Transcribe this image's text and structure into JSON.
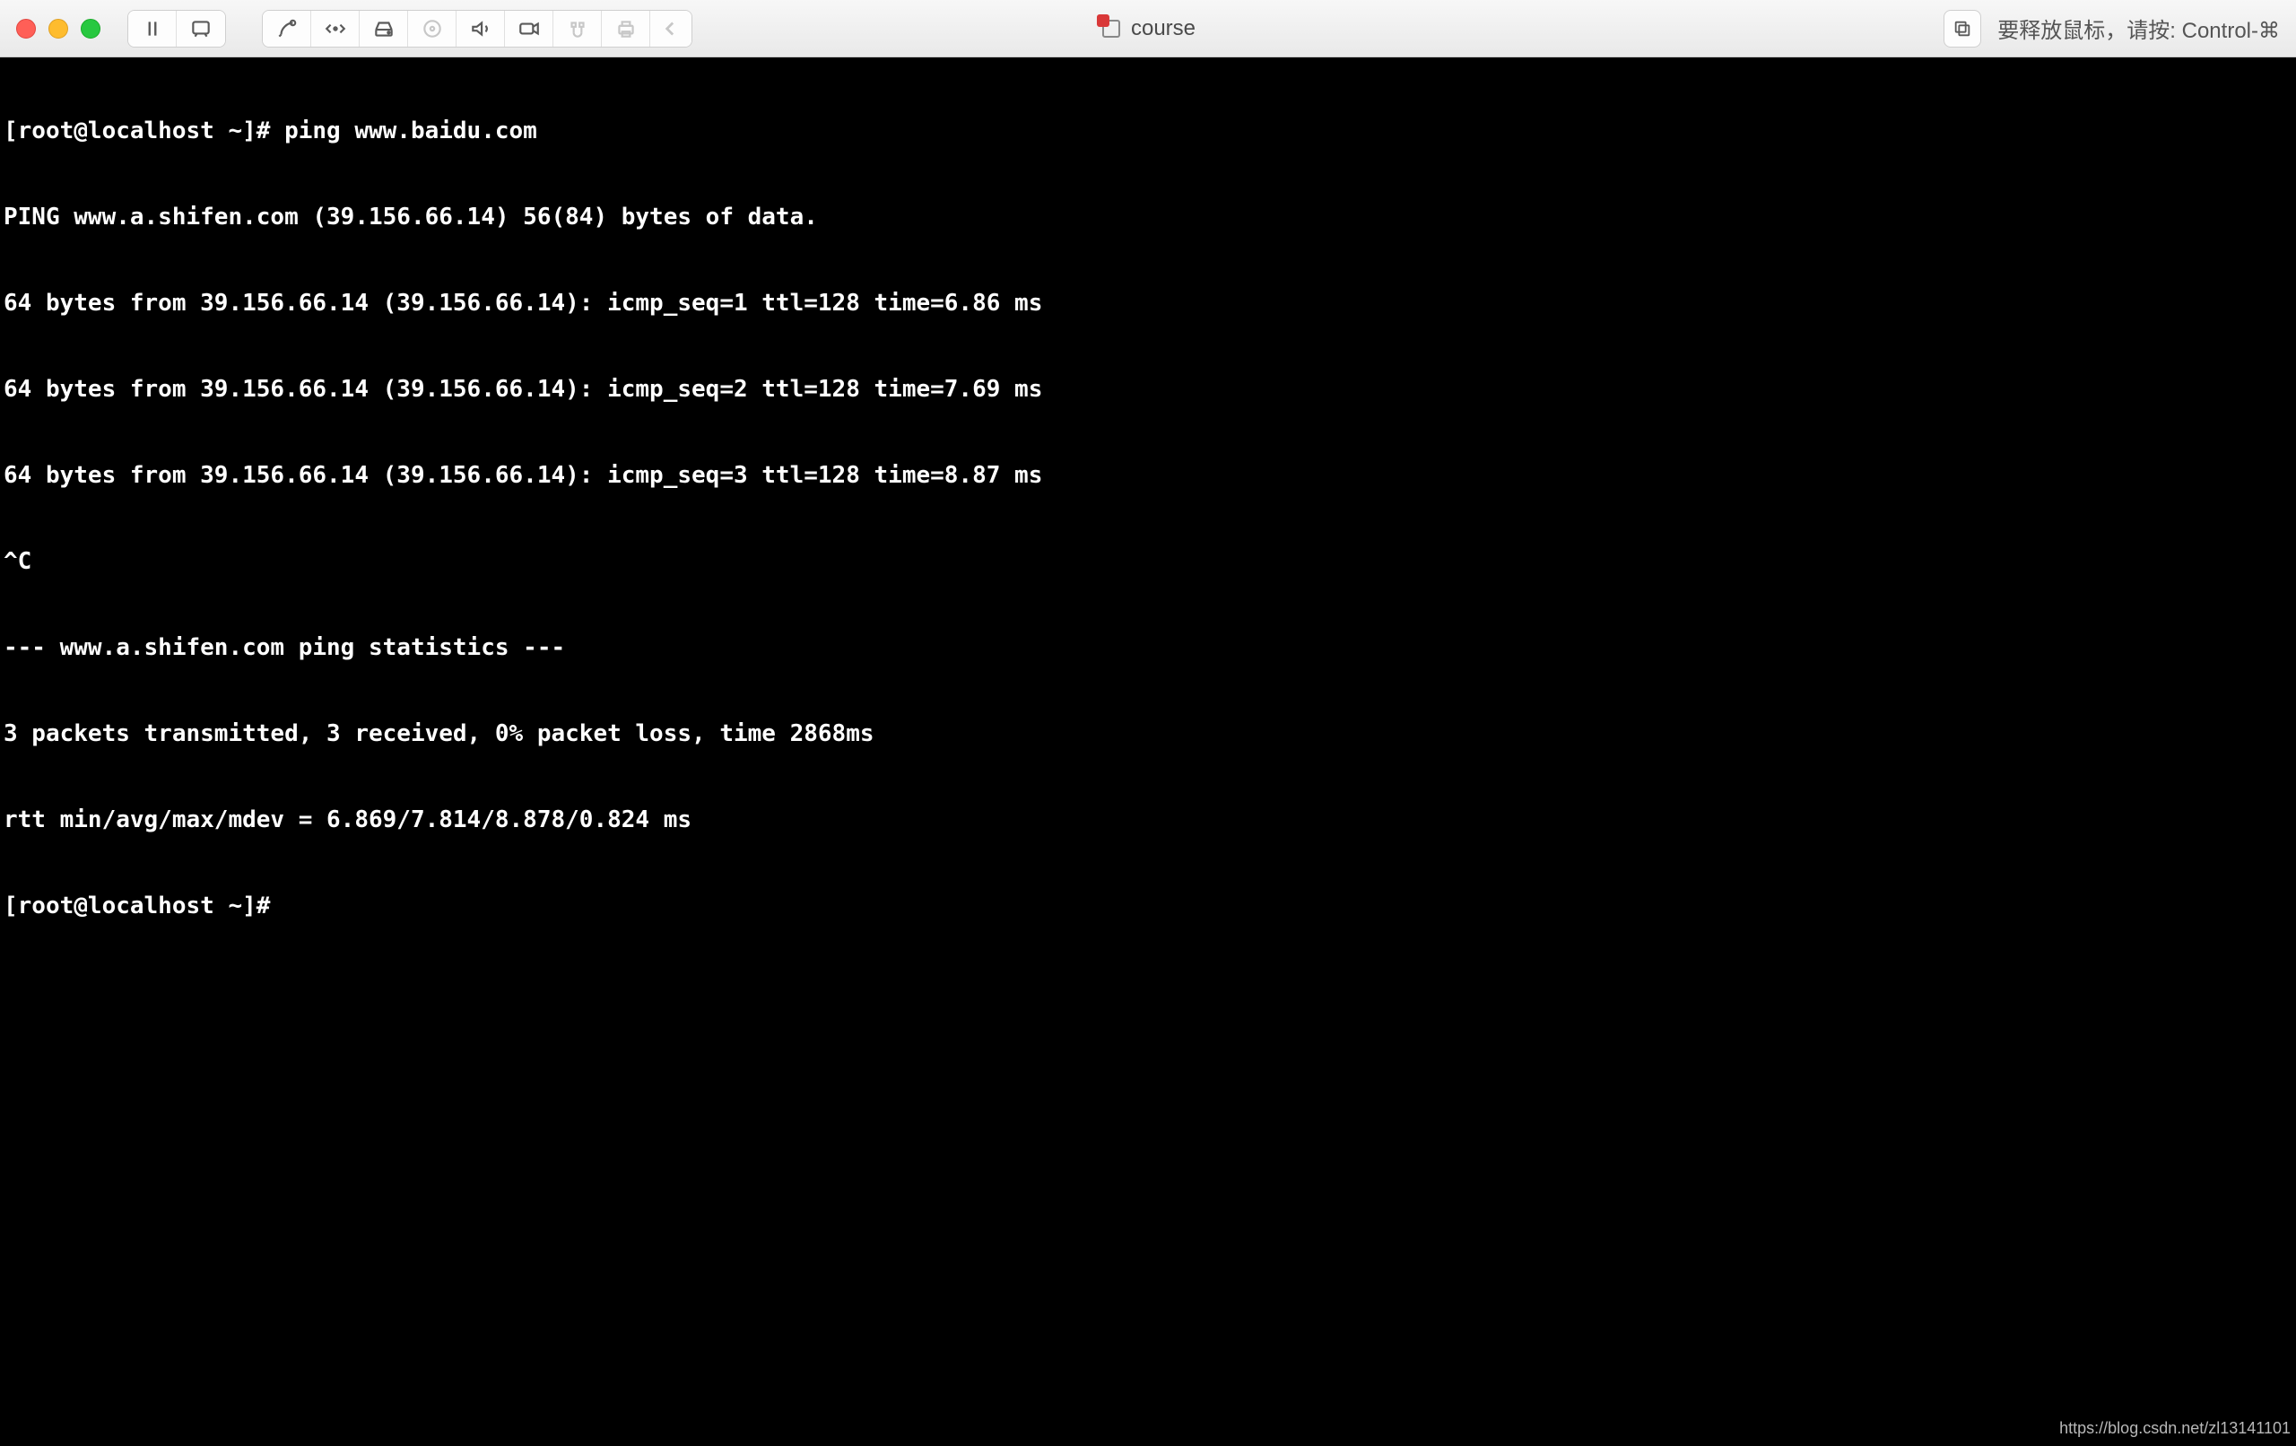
{
  "toolbar": {
    "title": "course",
    "hint": "要释放鼠标，请按: Control-⌘"
  },
  "terminal": {
    "lines": [
      "[root@localhost ~]# ping www.baidu.com",
      "PING www.a.shifen.com (39.156.66.14) 56(84) bytes of data.",
      "64 bytes from 39.156.66.14 (39.156.66.14): icmp_seq=1 ttl=128 time=6.86 ms",
      "64 bytes from 39.156.66.14 (39.156.66.14): icmp_seq=2 ttl=128 time=7.69 ms",
      "64 bytes from 39.156.66.14 (39.156.66.14): icmp_seq=3 ttl=128 time=8.87 ms",
      "^C",
      "--- www.a.shifen.com ping statistics ---",
      "3 packets transmitted, 3 received, 0% packet loss, time 2868ms",
      "rtt min/avg/max/mdev = 6.869/7.814/8.878/0.824 ms",
      "[root@localhost ~]# "
    ]
  },
  "watermark": "https://blog.csdn.net/zl13141101"
}
